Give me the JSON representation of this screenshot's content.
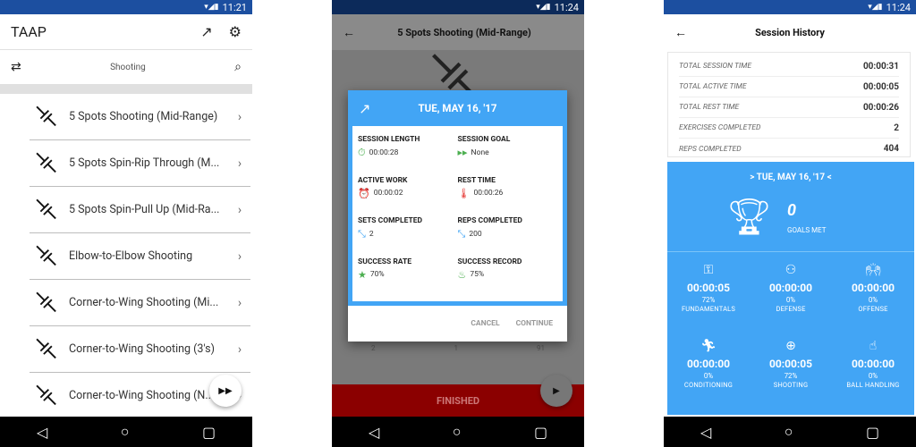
{
  "phone1": {
    "time": "11:21",
    "app_title": "TAAP",
    "category": "Shooting",
    "items": [
      "5 Spots Shooting (Mid-Range)",
      "5 Spots Spin-Rip Through (M...",
      "5 Spots Spin-Pull Up (Mid-Ra...",
      "Elbow-to-Elbow Shooting",
      "Corner-to-Wing Shooting (Mi...",
      "Corner-to-Wing Shooting (3's)",
      "Corner-to-Wing Shooting (N..."
    ]
  },
  "phone2": {
    "time": "11:24",
    "title": "5 Spots Shooting (Mid-Range)",
    "dialog": {
      "date": "TUE, MAY 16, '17",
      "session_length_label": "SESSION LENGTH",
      "session_length": "00:00:28",
      "session_goal_label": "SESSION GOAL",
      "session_goal": "None",
      "active_work_label": "ACTIVE WORK",
      "active_work": "00:00:02",
      "rest_time_label": "REST TIME",
      "rest_time": "00:00:26",
      "sets_completed_label": "SETS COMPLETED",
      "sets_completed": "2",
      "reps_completed_label": "REPS COMPLETED",
      "reps_completed": "200",
      "success_rate_label": "SUCCESS RATE",
      "success_rate": "70%",
      "success_record_label": "SUCCESS RECORD",
      "success_record": "75%",
      "cancel": "CANCEL",
      "continue": "CONTINUE"
    },
    "bg_numbers": [
      "2",
      "1",
      "91"
    ],
    "finished": "FINISHED"
  },
  "phone3": {
    "time": "11:24",
    "title": "Session History",
    "summary": [
      {
        "label": "TOTAL SESSION TIME",
        "value": "00:00:31"
      },
      {
        "label": "TOTAL ACTIVE TIME",
        "value": "00:00:05"
      },
      {
        "label": "TOTAL REST TIME",
        "value": "00:00:26"
      },
      {
        "label": "EXERCISES COMPLETED",
        "value": "2"
      },
      {
        "label": "REPS COMPLETED",
        "value": "404"
      }
    ],
    "date_nav": ">  TUE, MAY 16, '17  <",
    "goals_count": "0",
    "goals_label": "GOALS MET",
    "categories": [
      {
        "time": "00:00:05",
        "pct": "72%",
        "name": "FUNDAMENTALS"
      },
      {
        "time": "00:00:00",
        "pct": "0%",
        "name": "DEFENSE"
      },
      {
        "time": "00:00:00",
        "pct": "0%",
        "name": "OFFENSE"
      },
      {
        "time": "00:00:00",
        "pct": "0%",
        "name": "CONDITIONING"
      },
      {
        "time": "00:00:05",
        "pct": "72%",
        "name": "SHOOTING"
      },
      {
        "time": "00:00:00",
        "pct": "0%",
        "name": "BALL HANDLING"
      }
    ]
  }
}
